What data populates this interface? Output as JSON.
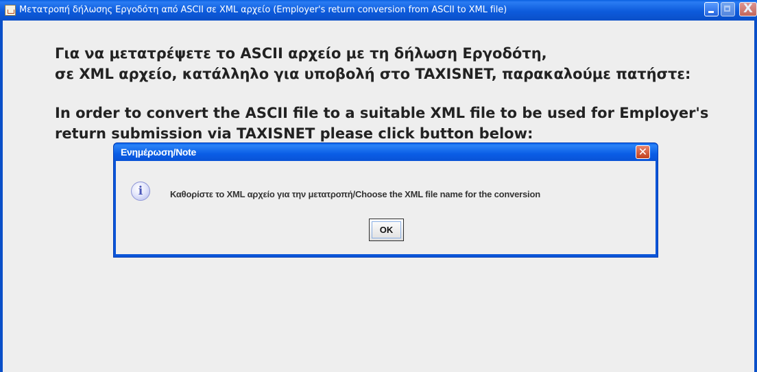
{
  "window": {
    "title": "Μετατροπή δήλωσης Εργοδότη από ASCII σε XML αρχείο (Employer's return conversion from ASCII to XML file)",
    "close_glyph": "X"
  },
  "message": {
    "line1": "Για να μετατρέψετε το ASCII αρχείο με τη δήλωση Εργοδότη,",
    "line2": "σε XML αρχείο, κατάλληλο για υποβολή στο TAXISNET, παρακαλούμε πατήστε:",
    "line3": "In order to convert the ASCII file to a suitable XML file to be used for Employer's",
    "line4": "return submission via TAXISNET please click button below:"
  },
  "dialog": {
    "title": "Ενημέρωση/Note",
    "close_glyph": "✕",
    "icon_glyph": "i",
    "text": "Καθορίστε το XML αρχείο για την μετατροπή/Choose the XML file name for the conversion",
    "ok_label": "OK"
  },
  "colors": {
    "titlebar": "#0a5fe0",
    "background": "#eeeeee",
    "text": "#222222"
  }
}
